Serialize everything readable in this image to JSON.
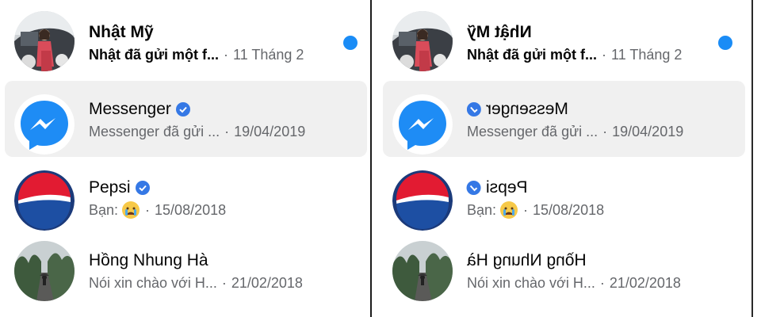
{
  "conversations": [
    {
      "name": "Nhật Mỹ",
      "preview": "Nhật đã gửi một f...",
      "date": "11 Tháng 2",
      "unread": true,
      "bold": true,
      "verified": false,
      "avatar_icon": "photo-avatar-woman-car"
    },
    {
      "name": "Messenger",
      "preview": "Messenger đã gửi ...",
      "date": "19/04/2019",
      "unread": false,
      "bold": false,
      "verified": true,
      "avatar_icon": "messenger-logo-icon"
    },
    {
      "name": "Pepsi",
      "preview": "Bạn:",
      "date": "15/08/2018",
      "unread": false,
      "bold": false,
      "verified": true,
      "avatar_icon": "pepsi-logo-icon",
      "emoji_icon": "crying-face-emoji"
    },
    {
      "name": "Hồng Nhung Hà",
      "preview": "Nói xin chào với H...",
      "date": "21/02/2018",
      "unread": false,
      "bold": false,
      "verified": false,
      "avatar_icon": "photo-avatar-landscape"
    }
  ],
  "colors": {
    "accent": "#1a8cf6",
    "verified": "#3578e5",
    "hover_bg": "#f0f0f0",
    "muted_text": "#65676b"
  },
  "separator": "·"
}
